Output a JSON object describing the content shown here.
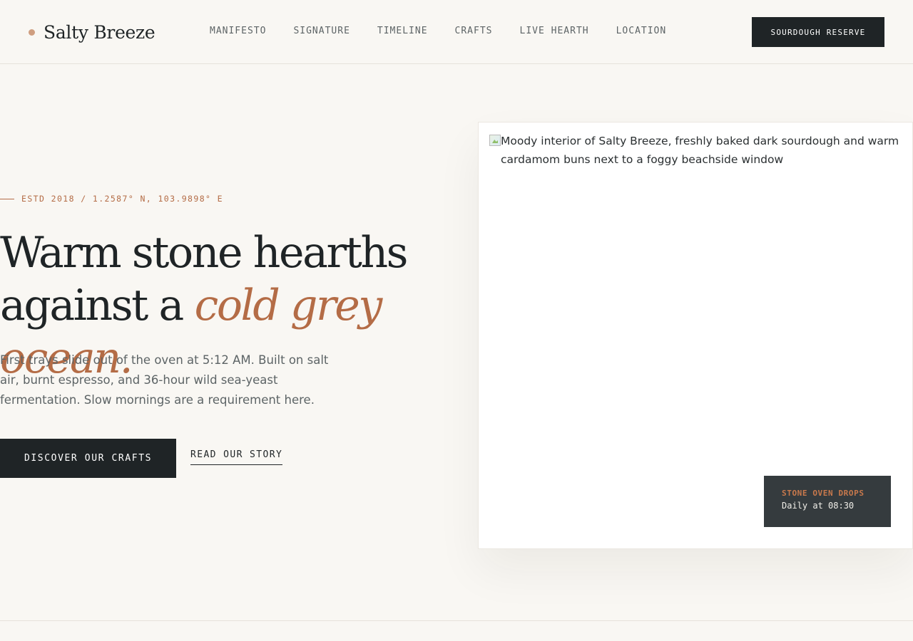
{
  "brand": {
    "name": "Salty Breeze",
    "accent_color": "#cf9e80"
  },
  "nav": {
    "items": [
      {
        "label": "MANIFESTO"
      },
      {
        "label": "SIGNATURE"
      },
      {
        "label": "TIMELINE"
      },
      {
        "label": "CRAFTS"
      },
      {
        "label": "LIVE HEARTH"
      },
      {
        "label": "LOCATION"
      }
    ],
    "reserve_label": "SOURDOUGH RESERVE"
  },
  "hero": {
    "eyebrow": "ESTD 2018 / 1.2587° N, 103.9898° E",
    "headline_line1": "Warm stone hearths",
    "headline_line2_prefix": "against a ",
    "headline_accent": "cold grey ocean.",
    "lede": "First trays slide out of the oven at 5:12 AM. Built on salt air, burnt espresso, and 36-hour wild sea-yeast fermentation. Slow mornings are a requirement here.",
    "primary_cta": "DISCOVER OUR CRAFTS",
    "secondary_cta": "READ OUR STORY"
  },
  "image_card": {
    "alt_text": "Moody interior of Salty Breeze, freshly baked dark sourdough and warm cardamom buns next to a foggy beachside window",
    "badge_title": "STONE OVEN DROPS",
    "badge_subtitle": "Daily at 08:30"
  },
  "colors": {
    "background": "#f9f7f3",
    "ink": "#1f2426",
    "accent": "#b46c46",
    "muted": "#5d6466",
    "badge_bg": "#353b3e"
  }
}
